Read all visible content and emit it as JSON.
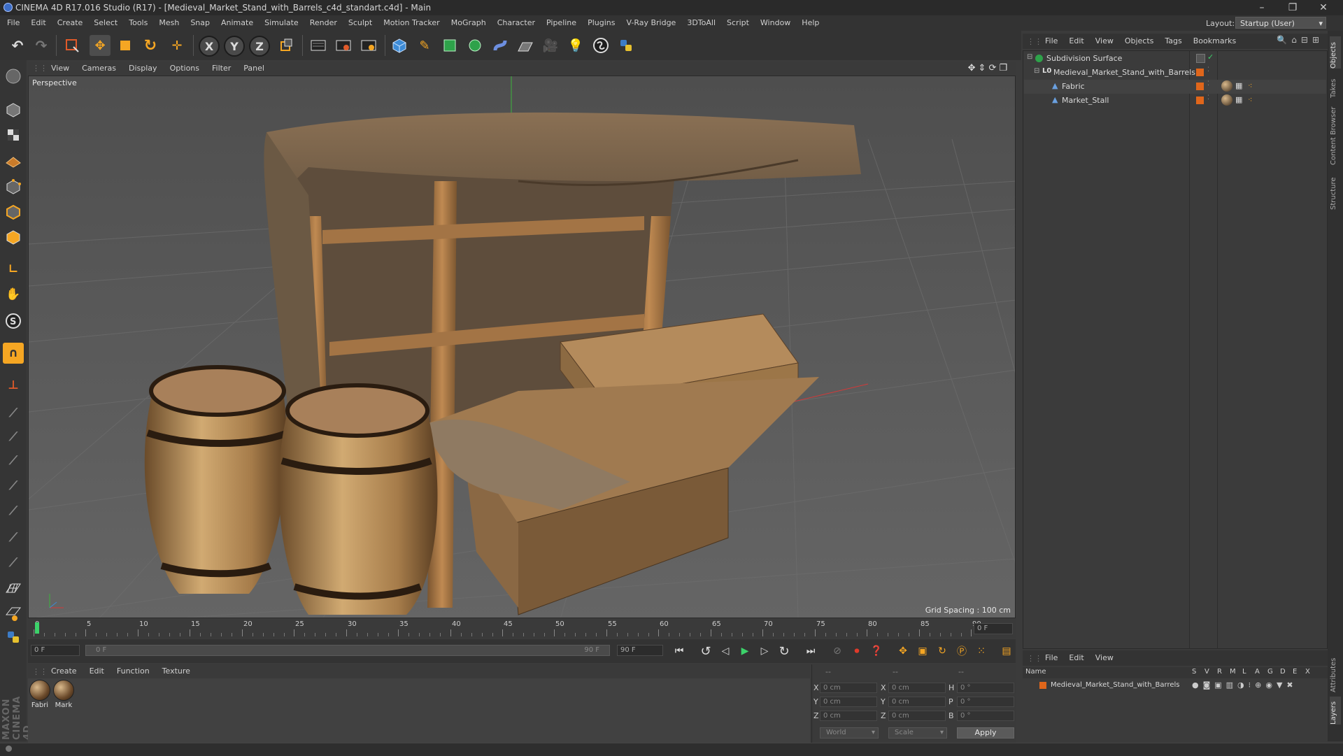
{
  "window": {
    "title": "CINEMA 4D R17.016 Studio (R17) - [Medieval_Market_Stand_with_Barrels_c4d_standart.c4d] - Main",
    "controls": [
      "–",
      "❐",
      "✕"
    ]
  },
  "menu": [
    "File",
    "Edit",
    "Create",
    "Select",
    "Tools",
    "Mesh",
    "Snap",
    "Animate",
    "Simulate",
    "Render",
    "Sculpt",
    "Motion Tracker",
    "MoGraph",
    "Character",
    "Pipeline",
    "Plugins",
    "V-Ray Bridge",
    "3DToAll",
    "Script",
    "Window",
    "Help"
  ],
  "layout": {
    "label": "Layout:",
    "value": "Startup (User)"
  },
  "toolbar": {
    "axis_x": "X",
    "axis_y": "Y",
    "axis_z": "Z"
  },
  "viewport": {
    "menu": [
      "View",
      "Cameras",
      "Display",
      "Options",
      "Filter",
      "Panel"
    ],
    "label": "Perspective",
    "grid_spacing": "Grid Spacing : 100 cm"
  },
  "timeline": {
    "ticks": [
      "0",
      "5",
      "10",
      "15",
      "20",
      "25",
      "30",
      "35",
      "40",
      "45",
      "50",
      "55",
      "60",
      "65",
      "70",
      "75",
      "80",
      "85",
      "90"
    ],
    "current_frame": "0 F",
    "start_field": "0 F",
    "range_start": "0 F",
    "range_end": "90 F",
    "end_field": "90 F"
  },
  "materials": {
    "menu": [
      "Create",
      "Edit",
      "Function",
      "Texture"
    ],
    "items": [
      {
        "label": "Fabri"
      },
      {
        "label": "Mark"
      }
    ]
  },
  "coordinates": {
    "col_headers": [
      "--",
      "--",
      "--"
    ],
    "rows": [
      {
        "a": "X",
        "av": "0 cm",
        "b": "X",
        "bv": "0 cm",
        "c": "H",
        "cv": "0 °"
      },
      {
        "a": "Y",
        "av": "0 cm",
        "b": "Y",
        "bv": "0 cm",
        "c": "P",
        "cv": "0 °"
      },
      {
        "a": "Z",
        "av": "0 cm",
        "b": "Z",
        "bv": "0 cm",
        "c": "B",
        "cv": "0 °"
      }
    ],
    "space": "World",
    "mode": "Scale",
    "apply": "Apply"
  },
  "object_manager": {
    "menu": [
      "File",
      "Edit",
      "View",
      "Objects",
      "Tags",
      "Bookmarks"
    ],
    "objects": [
      {
        "name": "Subdivision Surface"
      },
      {
        "name": "Medieval_Market_Stand_with_Barrels"
      },
      {
        "name": "Fabric"
      },
      {
        "name": "Market_Stall"
      }
    ]
  },
  "layers": {
    "menu": [
      "File",
      "Edit",
      "View"
    ],
    "headers": {
      "name": "Name",
      "cols": [
        "S",
        "V",
        "R",
        "M",
        "L",
        "A",
        "G",
        "D",
        "E",
        "X"
      ]
    },
    "rows": [
      {
        "name": "Medieval_Market_Stand_with_Barrels"
      }
    ]
  },
  "right_tabs": [
    "Objects",
    "Takes",
    "Content Browser",
    "Structure",
    "Attributes",
    "Layers"
  ],
  "branding": "MAXON CINEMA 4D",
  "colors": {
    "accent_orange": "#f5a623",
    "accent_blue": "#3d8bd6",
    "layer_orange": "#e0661b"
  }
}
